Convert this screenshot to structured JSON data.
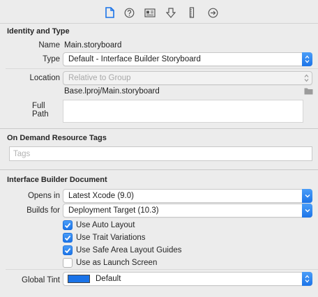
{
  "toolbar": {
    "icons": [
      "file-inspector-icon",
      "quick-help-icon",
      "identity-inspector-icon",
      "attributes-inspector-icon",
      "size-inspector-icon",
      "connections-inspector-icon"
    ]
  },
  "identity": {
    "title": "Identity and Type",
    "name_label": "Name",
    "name_value": "Main.storyboard",
    "type_label": "Type",
    "type_value": "Default - Interface Builder Storyboard",
    "location_label": "Location",
    "location_value": "Relative to Group",
    "path_value": "Base.lproj/Main.storyboard",
    "full_path_label": "Full Path",
    "full_path_value": ""
  },
  "tags": {
    "title": "On Demand Resource Tags",
    "placeholder": "Tags"
  },
  "ib_document": {
    "title": "Interface Builder Document",
    "opens_in_label": "Opens in",
    "opens_in_value": "Latest Xcode (9.0)",
    "builds_for_label": "Builds for",
    "builds_for_value": "Deployment Target (10.3)",
    "checkboxes": [
      {
        "label": "Use Auto Layout",
        "checked": true
      },
      {
        "label": "Use Trait Variations",
        "checked": true
      },
      {
        "label": "Use Safe Area Layout Guides",
        "checked": true
      },
      {
        "label": "Use as Launch Screen",
        "checked": false
      }
    ],
    "global_tint_label": "Global Tint",
    "global_tint_value": "Default",
    "global_tint_color": "#1a73e8"
  },
  "colors": {
    "accent": "#1c74e8",
    "active_icon": "#1a73e8"
  }
}
